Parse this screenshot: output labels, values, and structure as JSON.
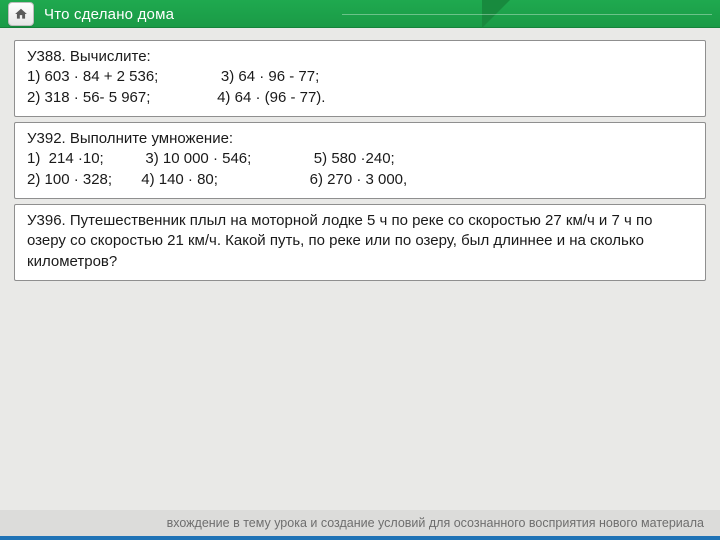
{
  "header": {
    "title": "Что сделано дома"
  },
  "cards": {
    "c1": {
      "title": "У388. Вычислите:",
      "line1": "1) 603 · 84 + 2 536;               3) 64 · 96 - 77;",
      "line2": "2) 318 · 56- 5 967;                4) 64 · (96 - 77)."
    },
    "c2": {
      "title": "У392. Выполните умножение:",
      "line1": "1)  214 ·10;          3) 10 000 · 546;               5) 580 ·240;",
      "line2": "2) 100 · 328;       4) 140 · 80;                      6) 270 · 3 000,"
    },
    "c3": {
      "text": "У396. Путешественник плыл на моторной лодке 5 ч по реке со скоростью 27 км/ч и 7 ч по озеру со скоростью 21 км/ч. Какой путь, по реке или по озеру, был длиннее и на сколько километров?"
    }
  },
  "footer": {
    "text": "вхождение в тему урока и создание условий для осознанного восприятия нового материала"
  }
}
